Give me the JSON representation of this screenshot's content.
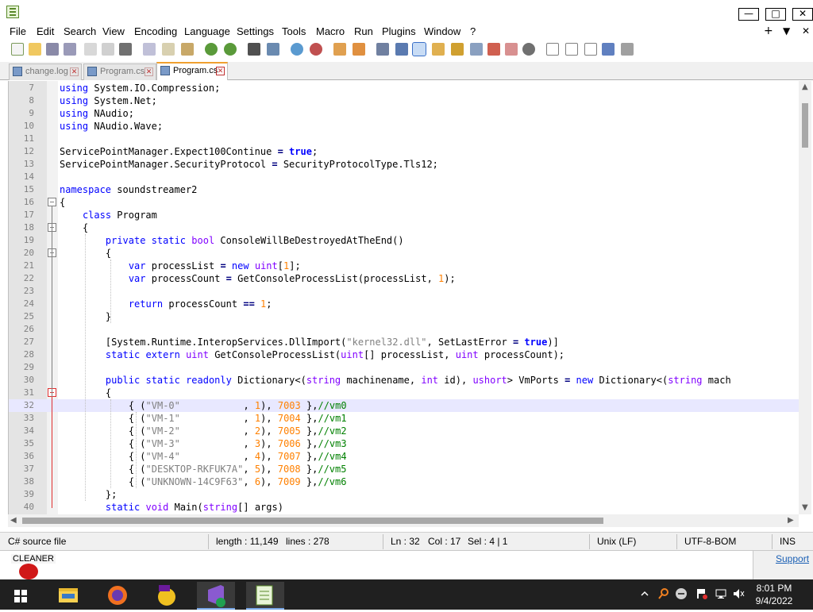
{
  "window": {
    "minimize": "—",
    "maximize": "□",
    "close": "✕"
  },
  "menu": {
    "items": [
      "File",
      "Edit",
      "Search",
      "View",
      "Encoding",
      "Language",
      "Settings",
      "Tools",
      "Macro",
      "Run",
      "Plugins",
      "Window",
      "?"
    ],
    "right": [
      "+",
      "▼",
      "✕"
    ]
  },
  "tabs": [
    {
      "label": "change.log",
      "active": false
    },
    {
      "label": "Program.cs",
      "active": false
    },
    {
      "label": "Program.cs",
      "active": true
    }
  ],
  "editor": {
    "current_line": 32,
    "lines": [
      {
        "n": "7",
        "t": "using System.IO.Compression;"
      },
      {
        "n": "8",
        "t": "using System.Net;"
      },
      {
        "n": "9",
        "t": "using NAudio;"
      },
      {
        "n": "10",
        "t": "using NAudio.Wave;"
      },
      {
        "n": "11",
        "t": ""
      },
      {
        "n": "12",
        "t": "ServicePointManager.Expect100Continue = true;"
      },
      {
        "n": "13",
        "t": "ServicePointManager.SecurityProtocol = SecurityProtocolType.Tls12;"
      },
      {
        "n": "14",
        "t": ""
      },
      {
        "n": "15",
        "t": "namespace soundstreamer2"
      },
      {
        "n": "16",
        "t": "{"
      },
      {
        "n": "17",
        "t": "    class Program"
      },
      {
        "n": "18",
        "t": "    {"
      },
      {
        "n": "19",
        "t": "        private static bool ConsoleWillBeDestroyedAtTheEnd()"
      },
      {
        "n": "20",
        "t": "        {"
      },
      {
        "n": "21",
        "t": "            var processList = new uint[1];"
      },
      {
        "n": "22",
        "t": "            var processCount = GetConsoleProcessList(processList, 1);"
      },
      {
        "n": "23",
        "t": ""
      },
      {
        "n": "24",
        "t": "            return processCount == 1;"
      },
      {
        "n": "25",
        "t": "        }"
      },
      {
        "n": "26",
        "t": ""
      },
      {
        "n": "27",
        "t": "        [System.Runtime.InteropServices.DllImport(\"kernel32.dll\", SetLastError = true)]"
      },
      {
        "n": "28",
        "t": "        static extern uint GetConsoleProcessList(uint[] processList, uint processCount);"
      },
      {
        "n": "29",
        "t": ""
      },
      {
        "n": "30",
        "t": "        public static readonly Dictionary<(string machinename, int id), ushort> VmPorts = new Dictionary<(string mach"
      },
      {
        "n": "31",
        "t": "        {"
      },
      {
        "n": "32",
        "t": "            { (\"VM-0\"           , 1), 7003 },//vm0"
      },
      {
        "n": "33",
        "t": "            { (\"VM-1\"           , 1), 7004 },//vm1"
      },
      {
        "n": "34",
        "t": "            { (\"VM-2\"           , 2), 7005 },//vm2"
      },
      {
        "n": "35",
        "t": "            { (\"VM-3\"           , 3), 7006 },//vm3"
      },
      {
        "n": "36",
        "t": "            { (\"VM-4\"           , 4), 7007 },//vm4"
      },
      {
        "n": "37",
        "t": "            { (\"DESKTOP-RKFUK7A\", 5), 7008 },//vm5"
      },
      {
        "n": "38",
        "t": "            { (\"UNKNOWN-14C9F63\", 6), 7009 },//vm6"
      },
      {
        "n": "39",
        "t": "        };"
      },
      {
        "n": "40",
        "t": "        static void Main(string[] args)"
      }
    ]
  },
  "status": {
    "file_type": "C# source file",
    "length": "length : 11,149",
    "lines": "lines : 278",
    "ln": "Ln : 32",
    "col": "Col : 17",
    "sel": "Sel : 4 | 1",
    "eol": "Unix (LF)",
    "encoding": "UTF-8-BOM",
    "mode": "INS"
  },
  "background": {
    "cleaner_label": "CLEANER",
    "support_link": "Support"
  },
  "taskbar": {
    "time": "8:01 PM",
    "date": "9/4/2022"
  },
  "colors": {
    "keyword": "#0000ff",
    "type": "#8000ff",
    "string": "#808080",
    "number": "#ff8000",
    "comment": "#008000",
    "active_tab_accent": "#f0a030",
    "taskbar": "#202020"
  }
}
